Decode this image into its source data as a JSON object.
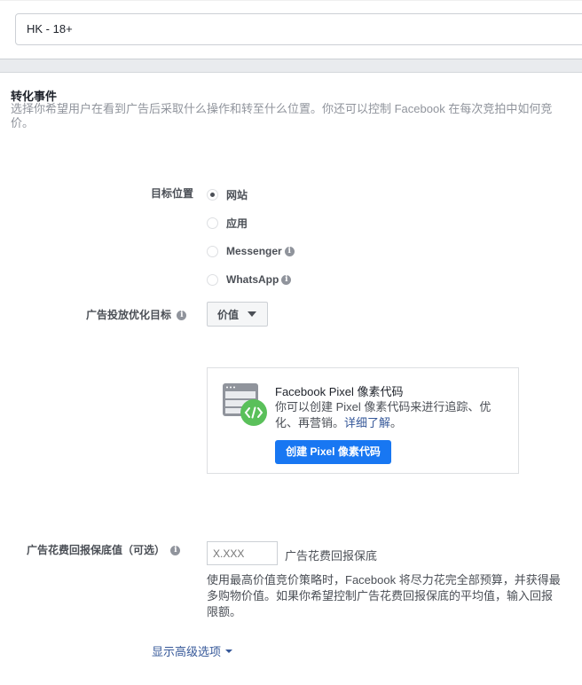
{
  "audience": {
    "value": "HK - 18+"
  },
  "conversion": {
    "title": "转化事件",
    "description": "选择你希望用户在看到广告后采取什么操作和转至什么位置。你还可以控制 Facebook 在每次竞拍中如何竞价。",
    "destination_label": "目标位置",
    "destinations": [
      {
        "label": "网站",
        "selected": true,
        "has_info": false
      },
      {
        "label": "应用",
        "selected": false,
        "has_info": false
      },
      {
        "label": "Messenger",
        "selected": false,
        "has_info": true
      },
      {
        "label": "WhatsApp",
        "selected": false,
        "has_info": true
      }
    ],
    "optimization_label": "广告投放优化目标",
    "optimization_value": "价值",
    "info_glyph": "i"
  },
  "pixel_card": {
    "icon": "browser-code-icon",
    "title": "Facebook Pixel 像素代码",
    "description": "你可以创建 Pixel 像素代码来进行追踪、优化、再营销。",
    "learn_more": "详细了解",
    "learn_more_suffix": "。",
    "button": "创建 Pixel 像素代码",
    "button_color": "#1877f2",
    "icon_green": "#5ac05a"
  },
  "roas": {
    "label": "广告花费回报保底值（可选）",
    "placeholder": "X.XXX",
    "suffix": "广告花费回报保底",
    "help": "使用最高价值竞价策略时，Facebook 将尽力花完全部预算，并获得最多购物价值。如果你希望控制广告花费回报保底的平均值，输入回报限额。"
  },
  "advanced": {
    "label": "显示高级选项"
  }
}
